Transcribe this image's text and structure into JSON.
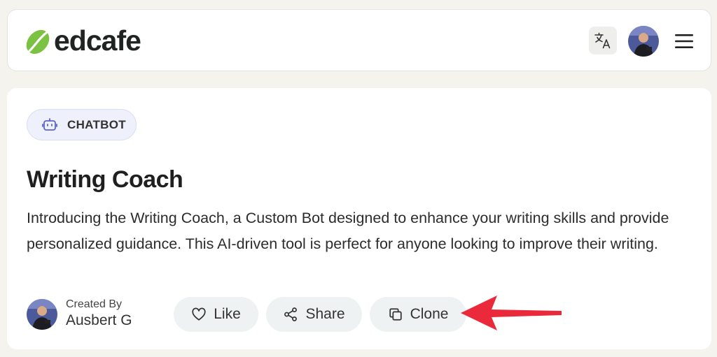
{
  "header": {
    "logo_text": "edcafe",
    "brand_color": "#7cc242",
    "translate_icon": "translate-icon",
    "menu_icon": "hamburger-menu-icon"
  },
  "card": {
    "tag_label": "CHATBOT",
    "tag_icon": "robot-icon",
    "title": "Writing Coach",
    "description": "Introducing the Writing Coach, a Custom Bot designed to enhance your writing skills and provide personalized guidance. This AI-driven tool is perfect for anyone looking to improve their writing.",
    "created_by_label": "Created By",
    "creator_name": "Ausbert G",
    "actions": {
      "like": "Like",
      "share": "Share",
      "clone": "Clone"
    }
  },
  "annotation": {
    "arrow_color": "#ea2a3b"
  }
}
